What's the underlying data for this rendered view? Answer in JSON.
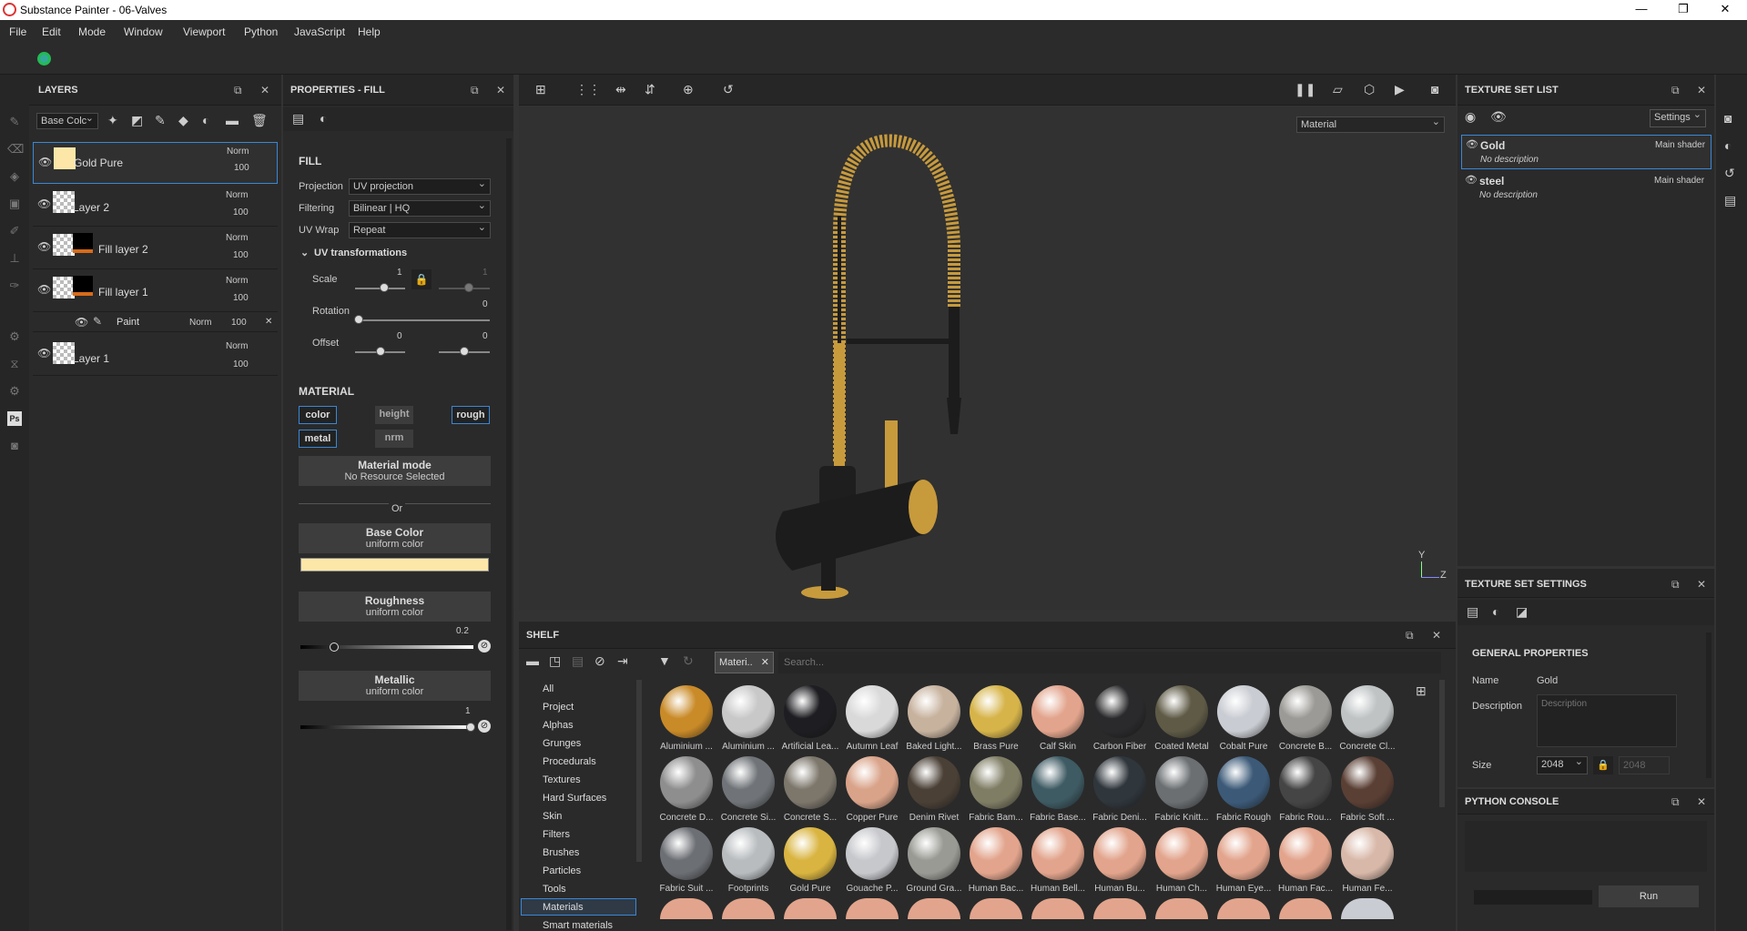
{
  "window": {
    "title": "Substance Painter - 06-Valves",
    "min": "—",
    "max": "❐",
    "close": "✕"
  },
  "menu": [
    "File",
    "Edit",
    "Mode",
    "Window",
    "Viewport",
    "Python",
    "JavaScript",
    "Help"
  ],
  "layers": {
    "title": "LAYERS",
    "channel_select": "Base Colc",
    "items": [
      {
        "name": "Gold Pure",
        "blend": "Norm",
        "opacity": "100"
      },
      {
        "name": "Layer 2",
        "blend": "Norm",
        "opacity": "100"
      },
      {
        "name": "Fill layer 2",
        "blend": "Norm",
        "opacity": "100"
      },
      {
        "name": "Fill layer 1",
        "blend": "Norm",
        "opacity": "100"
      },
      {
        "name": "Layer 1",
        "blend": "Norm",
        "opacity": "100"
      }
    ],
    "effect": {
      "name": "Paint",
      "blend": "Norm",
      "opacity": "100"
    }
  },
  "props": {
    "title": "PROPERTIES - FILL",
    "fill": "FILL",
    "projection_label": "Projection",
    "projection": "UV projection",
    "filtering_label": "Filtering",
    "filtering": "Bilinear | HQ",
    "uvwrap_label": "UV Wrap",
    "uvwrap": "Repeat",
    "uvt": "UV transformations",
    "scale_label": "Scale",
    "scale_a": "1",
    "scale_b": "1",
    "rotation_label": "Rotation",
    "rotation": "0",
    "offset_label": "Offset",
    "offset_a": "0",
    "offset_b": "0",
    "material": "MATERIAL",
    "channels": {
      "color": "color",
      "height": "height",
      "rough": "rough",
      "metal": "metal",
      "nrm": "nrm"
    },
    "mode_title": "Material mode",
    "mode_sub": "No Resource Selected",
    "or": "Or",
    "base_title": "Base Color",
    "base_sub": "uniform color",
    "rough_title": "Roughness",
    "rough_sub": "uniform color",
    "rough_val": "0.2",
    "metal_title": "Metallic",
    "metal_sub": "uniform color",
    "metal_val": "1",
    "base_swatch": "#fde7a8"
  },
  "viewport": {
    "mode": "Material",
    "axis_y": "Y",
    "axis_z": "Z"
  },
  "tsl": {
    "title": "TEXTURE SET LIST",
    "settings": "Settings",
    "items": [
      {
        "name": "Gold",
        "shader": "Main shader",
        "desc": "No description"
      },
      {
        "name": "steel",
        "shader": "Main shader",
        "desc": "No description"
      }
    ]
  },
  "tss": {
    "title": "TEXTURE SET SETTINGS",
    "general": "GENERAL PROPERTIES",
    "name_label": "Name",
    "name": "Gold",
    "desc_label": "Description",
    "desc_placeholder": "Description",
    "size_label": "Size",
    "size": "2048",
    "size2": "2048"
  },
  "python": {
    "title": "PYTHON CONSOLE",
    "run": "Run"
  },
  "shelf": {
    "title": "SHELF",
    "tag": "Materi..",
    "search_placeholder": "Search...",
    "categories": [
      "All",
      "Project",
      "Alphas",
      "Grunges",
      "Procedurals",
      "Textures",
      "Hard Surfaces",
      "Skin",
      "Filters",
      "Brushes",
      "Particles",
      "Tools",
      "Materials",
      "Smart materials"
    ],
    "selected": "Materials",
    "materials": [
      {
        "name": "Aluminium ...",
        "color": "#c98a28"
      },
      {
        "name": "Aluminium ...",
        "color": "#c8c8c8"
      },
      {
        "name": "Artificial Lea...",
        "color": "#1e1e22"
      },
      {
        "name": "Autumn Leaf",
        "color": "#d9d9d9"
      },
      {
        "name": "Baked Light...",
        "color": "#c7b29e"
      },
      {
        "name": "Brass Pure",
        "color": "#d6b44a"
      },
      {
        "name": "Calf Skin",
        "color": "#e2a48c"
      },
      {
        "name": "Carbon Fiber",
        "color": "#2a2a2c"
      },
      {
        "name": "Coated Metal",
        "color": "#5f5a46"
      },
      {
        "name": "Cobalt Pure",
        "color": "#c9ccd2"
      },
      {
        "name": "Concrete B...",
        "color": "#9c9a96"
      },
      {
        "name": "Concrete Cl...",
        "color": "#bfc3c4"
      },
      {
        "name": "Concrete D...",
        "color": "#8e8e8e"
      },
      {
        "name": "Concrete Si...",
        "color": "#707478"
      },
      {
        "name": "Concrete S...",
        "color": "#7c766b"
      },
      {
        "name": "Copper Pure",
        "color": "#d9a389"
      },
      {
        "name": "Denim Rivet",
        "color": "#4a4036"
      },
      {
        "name": "Fabric Bam...",
        "color": "#7f7d64"
      },
      {
        "name": "Fabric Base...",
        "color": "#3e5a63"
      },
      {
        "name": "Fabric Deni...",
        "color": "#2f363c"
      },
      {
        "name": "Fabric Knitt...",
        "color": "#6b6f72"
      },
      {
        "name": "Fabric Rough",
        "color": "#3c5a78"
      },
      {
        "name": "Fabric Rou...",
        "color": "#454545"
      },
      {
        "name": "Fabric Soft ...",
        "color": "#5a3f34"
      },
      {
        "name": "Fabric Suit ...",
        "color": "#6c6f74"
      },
      {
        "name": "Footprints",
        "color": "#b8bcbf"
      },
      {
        "name": "Gold Pure",
        "color": "#d9b440"
      },
      {
        "name": "Gouache P...",
        "color": "#c7c8cc"
      },
      {
        "name": "Ground Gra...",
        "color": "#9a9a94"
      },
      {
        "name": "Human Bac...",
        "color": "#e2a48c"
      },
      {
        "name": "Human Bell...",
        "color": "#e2a48c"
      },
      {
        "name": "Human Bu...",
        "color": "#e2a48c"
      },
      {
        "name": "Human Ch...",
        "color": "#e2a48c"
      },
      {
        "name": "Human Eye...",
        "color": "#e2a48c"
      },
      {
        "name": "Human Fac...",
        "color": "#e2a48c"
      },
      {
        "name": "Human Fe...",
        "color": "#d8b8a8"
      }
    ]
  }
}
